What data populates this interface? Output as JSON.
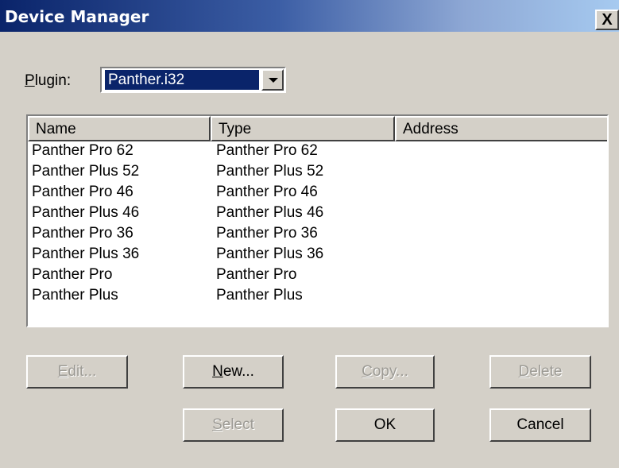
{
  "window": {
    "title": "Device Manager",
    "close_label": "X"
  },
  "plugin": {
    "label_accel": "P",
    "label_rest": "lugin:",
    "selected": "Panther.i32"
  },
  "list": {
    "columns": [
      "Name",
      "Type",
      "Address"
    ],
    "rows": [
      {
        "name": "Panther Pro 62",
        "type": "Panther Pro 62",
        "address": ""
      },
      {
        "name": "Panther Plus 52",
        "type": "Panther Plus 52",
        "address": ""
      },
      {
        "name": "Panther Pro 46",
        "type": "Panther Pro 46",
        "address": ""
      },
      {
        "name": "Panther Plus 46",
        "type": "Panther Plus 46",
        "address": ""
      },
      {
        "name": "Panther Pro 36",
        "type": "Panther Pro 36",
        "address": ""
      },
      {
        "name": "Panther Plus 36",
        "type": "Panther Plus 36",
        "address": ""
      },
      {
        "name": "Panther Pro",
        "type": "Panther Pro",
        "address": ""
      },
      {
        "name": "Panther Plus",
        "type": "Panther Plus",
        "address": ""
      }
    ]
  },
  "buttons": {
    "edit": {
      "accel": "E",
      "rest": "dit...",
      "enabled": false
    },
    "new": {
      "accel": "N",
      "rest": "ew...",
      "enabled": true
    },
    "copy": {
      "accel": "C",
      "rest": "opy...",
      "enabled": false
    },
    "delete": {
      "accel": "D",
      "rest": "elete",
      "enabled": false
    },
    "select": {
      "accel": "S",
      "rest": "elect",
      "enabled": false
    },
    "ok": {
      "label": "OK",
      "enabled": true
    },
    "cancel": {
      "label": "Cancel",
      "enabled": true
    }
  }
}
